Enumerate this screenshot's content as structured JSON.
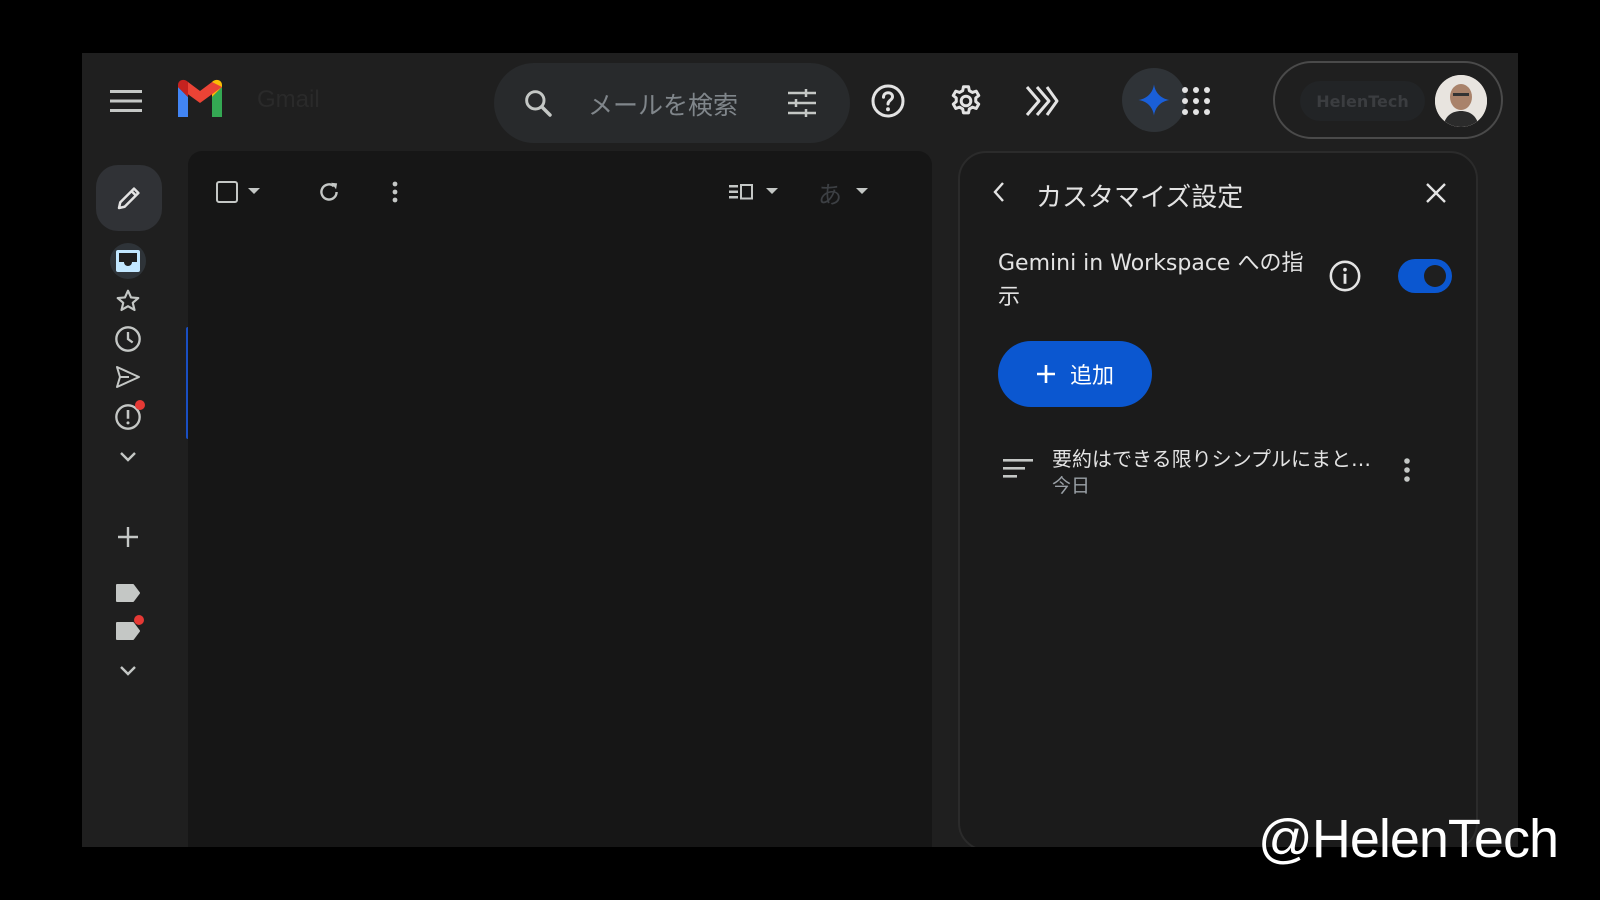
{
  "app": {
    "logo_text": "Gmail"
  },
  "search": {
    "placeholder": "メールを検索"
  },
  "account": {
    "name": "HelenTech"
  },
  "list_toolbar": {
    "ime_label": "あ"
  },
  "customize_panel": {
    "title": "カスタマイズ設定",
    "setting_label": "Gemini in Workspace への指示",
    "toggle_on": true,
    "add_label": "追加",
    "instruction": {
      "title": "要約はできる限りシンプルにまと…",
      "date": "今日"
    }
  },
  "watermark": "@HelenTech",
  "colors": {
    "accent": "#0b57d0",
    "background": "#1f1f1f",
    "panel": "#161616",
    "notification": "#e53935"
  },
  "icons": [
    "menu-icon",
    "gmail-logo",
    "search-icon",
    "filter-icon",
    "help-icon",
    "settings-icon",
    "gemini-chevrons-icon",
    "gemini-sparkle-icon",
    "apps-icon",
    "pencil-icon",
    "inbox-icon",
    "star-icon",
    "clock-icon",
    "send-icon",
    "important-icon",
    "chevron-down-icon",
    "plus-icon",
    "label-icon",
    "checkbox-icon",
    "refresh-icon",
    "more-vert-icon",
    "split-view-icon",
    "back-icon",
    "close-icon",
    "info-icon",
    "sort-icon"
  ]
}
